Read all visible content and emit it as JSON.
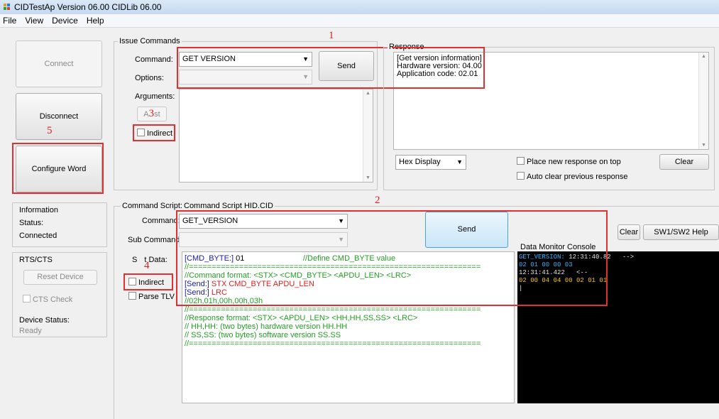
{
  "window": {
    "title": "CIDTestAp Version 06.00   CIDLib 06.00"
  },
  "menu": [
    "File",
    "View",
    "Device",
    "Help"
  ],
  "left_panel": {
    "connect_label": "Connect",
    "disconnect_label": "Disconnect",
    "configure_label": "Configure Word",
    "information_title": "Information",
    "status_label": "Status:",
    "status_value": "Connected",
    "rts_title": "RTS/CTS",
    "reset_label": "Reset Device",
    "cts_check_label": "CTS Check",
    "device_status_label": "Device Status:",
    "device_status_value": "Ready"
  },
  "issue_commands": {
    "title": "Issue Commands",
    "command_label": "Command:",
    "command_value": "GET VERSION",
    "options_label": "Options:",
    "options_value": "",
    "arguments_label": "Arguments:",
    "list_label": "A",
    "list_label_tail": "st",
    "indirect_label": "Indirect",
    "send_label": "Send"
  },
  "response": {
    "title": "Response",
    "lines": [
      "[Get version information]",
      "Hardware version: 04.00",
      "Application code: 02.01"
    ],
    "display_mode": "Hex Display",
    "place_top_label": "Place new response on top",
    "auto_clear_label": "Auto clear previous response",
    "clear_label": "Clear"
  },
  "script": {
    "command_script_label": "Command Script:",
    "command_script_value": "Command Script HID.CID",
    "command_label": "Command:",
    "command_value": "GET_VERSION",
    "sub_command_label": "Sub Command:",
    "sub_command_value": "",
    "script_data_label_start": "S",
    "script_data_label_end": "t Data:",
    "indirect_label": "Indirect",
    "parse_tlv_label": "Parse TLV",
    "send_label": "Send",
    "clear_label": "Clear",
    "sw_help_label": "SW1/SW2 Help",
    "monitor_title": "Data Monitor Console",
    "lines": [
      [
        {
          "t": "[CMD_BYTE:]",
          "c": "blue"
        },
        {
          "t": " 01                           //Define CMD_BYTE value",
          "c": "black_green"
        }
      ],
      [
        {
          "t": "//================================================================",
          "c": "green"
        }
      ],
      [
        {
          "t": "//Command format: <STX> <CMD_BYTE> <APDU_LEN> <LRC>",
          "c": "green"
        }
      ],
      [
        {
          "t": "[Send:]",
          "c": "blue"
        },
        {
          "t": " STX CMD_BYTE APDU_LEN",
          "c": "red"
        }
      ],
      [
        {
          "t": "[Send:]",
          "c": "blue"
        },
        {
          "t": " LRC",
          "c": "red"
        }
      ],
      [
        {
          "t": "//02h,01h,00h,00h,03h",
          "c": "green"
        }
      ],
      [
        {
          "t": "//================================================================",
          "c": "green"
        }
      ],
      [
        {
          "t": "//Response format: <STX> <APDU_LEN> <HH,HH,SS,SS> <LRC>",
          "c": "green"
        }
      ],
      [
        {
          "t": "// HH,HH: (two bytes) hardware version HH.HH",
          "c": "green"
        }
      ],
      [
        {
          "t": "// SS,SS: (two bytes) software version SS.SS",
          "c": "green"
        }
      ],
      [
        {
          "t": "//================================================================",
          "c": "green"
        }
      ]
    ],
    "console_lines": [
      [
        {
          "t": "GET_VERSION:",
          "c": "cyan"
        },
        {
          "t": " 12:31:40.8",
          "c": "white"
        },
        {
          "t": "",
          "c": "white"
        },
        {
          "t": "2   -->",
          "c": "white"
        }
      ],
      [
        {
          "t": "02 01 00 00 03",
          "c": "cyan"
        }
      ],
      [
        {
          "t": "12:31:41.422   <--",
          "c": "white"
        }
      ],
      [
        {
          "t": "02 00 04 04 00 02 01 01",
          "c": "yellow"
        }
      ],
      [
        {
          "t": "|",
          "c": "white"
        }
      ]
    ]
  },
  "annotations": [
    "1",
    "2",
    "3",
    "4",
    "5"
  ],
  "colors": {
    "annotation": "#e03030",
    "console_bg": "#000000"
  }
}
